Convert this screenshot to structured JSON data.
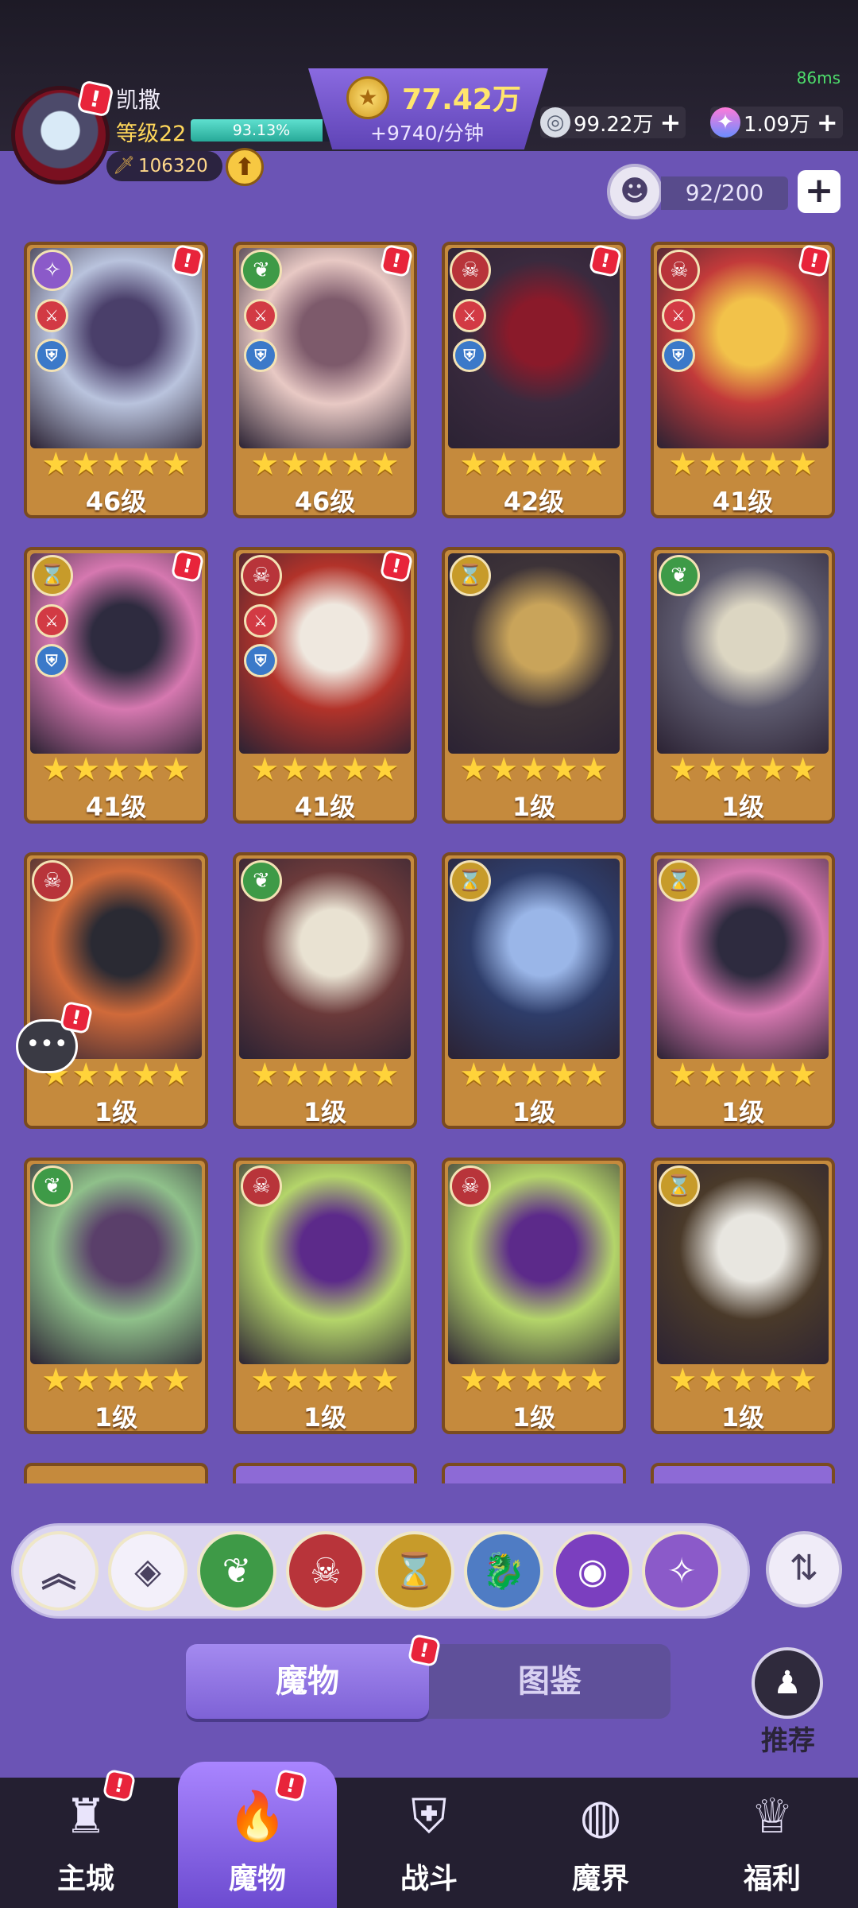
{
  "header": {
    "fps": "86ms",
    "player_name": "凯撒",
    "player_level": "等级22",
    "xp_percent": "93.13%",
    "xp_fraction": 0.9313,
    "combat_power": "106320",
    "gold_amount": "77.42万",
    "gold_rate": "+9740/分钟",
    "currency1_value": "99.22万",
    "currency2_value": "1.09万",
    "capacity": "92/200",
    "add_symbol": "+"
  },
  "colors": {
    "accent_purple": "#6b54b5",
    "card_gold": "#c58a3d",
    "alert_red": "#e8243b",
    "star_yellow": "#ffd33a"
  },
  "elements": {
    "arcane": {
      "icon": "arcane-swirl-icon",
      "color": "#8b5ac9"
    },
    "nature": {
      "icon": "leaf-icon",
      "color": "#3e9a47"
    },
    "demon": {
      "icon": "demon-mask-icon",
      "color": "#b8343a"
    },
    "time": {
      "icon": "hourglass-icon",
      "color": "#c79b2a"
    },
    "dragon": {
      "icon": "dragon-icon",
      "color": "#4f7cc4"
    },
    "eye": {
      "icon": "eye-icon",
      "color": "#7b3fbf"
    }
  },
  "monsters": [
    {
      "level": "46级",
      "element": "arcane",
      "stars": 5,
      "alert": true,
      "sword": true,
      "shield": true
    },
    {
      "level": "46级",
      "element": "nature",
      "stars": 5,
      "alert": true,
      "sword": true,
      "shield": true
    },
    {
      "level": "42级",
      "element": "demon",
      "stars": 5,
      "alert": true,
      "sword": true,
      "shield": true
    },
    {
      "level": "41级",
      "element": "demon",
      "stars": 5,
      "alert": true,
      "sword": true,
      "shield": true
    },
    {
      "level": "41级",
      "element": "time",
      "stars": 5,
      "alert": true,
      "sword": true,
      "shield": true
    },
    {
      "level": "41级",
      "element": "demon",
      "stars": 5,
      "alert": true,
      "sword": true,
      "shield": true
    },
    {
      "level": "1级",
      "element": "time",
      "stars": 5,
      "alert": false
    },
    {
      "level": "1级",
      "element": "nature",
      "stars": 5,
      "alert": false
    },
    {
      "level": "1级",
      "element": "demon",
      "stars": 5,
      "alert": false
    },
    {
      "level": "1级",
      "element": "nature",
      "stars": 5,
      "alert": false
    },
    {
      "level": "1级",
      "element": "time",
      "stars": 5,
      "alert": false
    },
    {
      "level": "1级",
      "element": "time",
      "stars": 5,
      "alert": false
    },
    {
      "level": "1级",
      "element": "nature",
      "stars": 5,
      "alert": false
    },
    {
      "level": "1级",
      "element": "demon",
      "stars": 5,
      "alert": false
    },
    {
      "level": "1级",
      "element": "demon",
      "stars": 5,
      "alert": false
    },
    {
      "level": "1级",
      "element": "time",
      "stars": 5,
      "alert": false
    }
  ],
  "filters": [
    {
      "name": "collapse",
      "icon": "double-chevron-up-icon"
    },
    {
      "name": "all",
      "icon": "diamond-grid-icon"
    },
    {
      "name": "nature",
      "icon": "leaf-icon"
    },
    {
      "name": "demon",
      "icon": "demon-mask-icon"
    },
    {
      "name": "time",
      "icon": "hourglass-icon"
    },
    {
      "name": "dragon",
      "icon": "dragon-icon"
    },
    {
      "name": "eye",
      "icon": "eye-icon"
    },
    {
      "name": "arcane",
      "icon": "arcane-swirl-icon"
    }
  ],
  "tabs": {
    "monsters": "魔物",
    "codex": "图鉴"
  },
  "recommend_label": "推荐",
  "nav": [
    {
      "label": "主城",
      "icon": "castle-icon",
      "alert": true
    },
    {
      "label": "魔物",
      "icon": "purple-flame-icon",
      "alert": true,
      "active": true
    },
    {
      "label": "战斗",
      "icon": "shield-sword-icon",
      "alert": false
    },
    {
      "label": "魔界",
      "icon": "portal-icon",
      "alert": false
    },
    {
      "label": "福利",
      "icon": "treasure-chest-icon",
      "alert": false
    }
  ]
}
